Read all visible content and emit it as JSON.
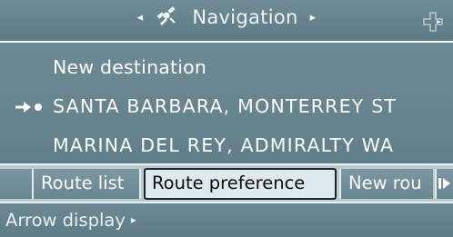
{
  "header": {
    "title": "Navigation",
    "left_arrow": "◂",
    "right_arrow": "▸",
    "icons": [
      "satellite-icon",
      "dpad-icon"
    ]
  },
  "destinations": {
    "new_destination_label": "New destination",
    "items": [
      {
        "label": "SANTA BARBARA, MONTERREY ST",
        "current": true
      },
      {
        "label": "MARINA DEL REY, ADMIRALTY WA",
        "current": false
      }
    ]
  },
  "tabs": {
    "items": [
      {
        "label": "Route list",
        "selected": false
      },
      {
        "label": "Route preference",
        "selected": true
      },
      {
        "label": "New rou",
        "selected": false
      }
    ],
    "more_icon": "double-chevron-right-icon"
  },
  "bottom": {
    "arrow_display_label": "Arrow display",
    "arrow": "▸"
  },
  "colors": {
    "panel": "#6e8a95",
    "panel_light": "#bfcfd5",
    "selected_tab": "#dfeaee",
    "text": "#ffffff"
  }
}
